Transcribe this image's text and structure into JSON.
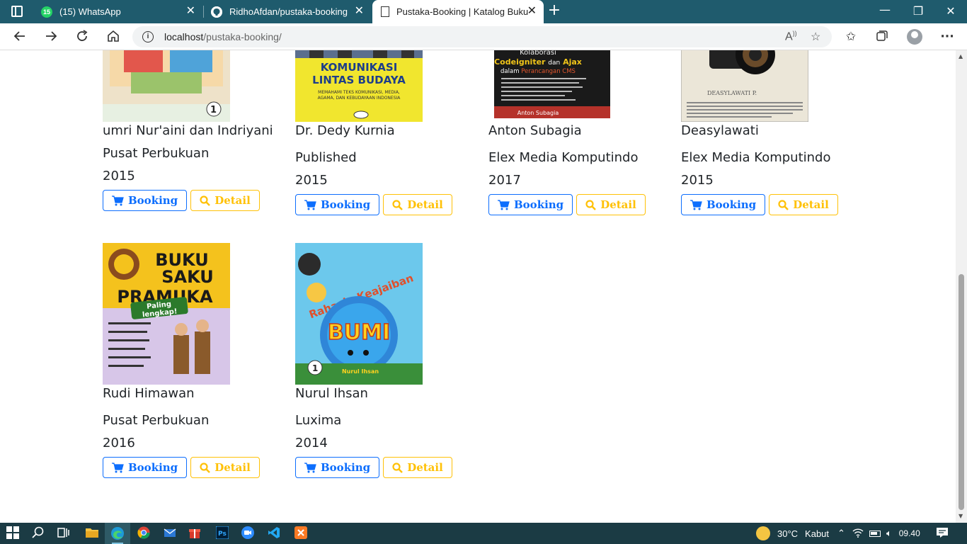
{
  "browser": {
    "tabs": [
      {
        "title": "(15) WhatsApp",
        "badge": "15"
      },
      {
        "title": "RidhoAfdan/pustaka-booking"
      },
      {
        "title": "Pustaka-Booking | Katalog Buku"
      }
    ],
    "url_host": "localhost",
    "url_path": "/pustaka-booking/",
    "icons": {
      "tab_actions": "tabs-icon",
      "back": "back-arrow-icon",
      "forward": "forward-arrow-icon",
      "refresh": "refresh-icon",
      "home": "home-icon",
      "info": "info-icon",
      "read_aloud": "read-aloud-icon",
      "add_favorite": "add-favorite-icon",
      "favorites": "favorites-icon",
      "collections": "collections-icon",
      "profile": "profile-avatar",
      "more": "more-icon"
    }
  },
  "books": [
    {
      "author": "umri Nur'aini dan Indriyani",
      "publisher": "Pusat Perbukuan",
      "year": "2015",
      "cover_text": "",
      "booking_label": "Booking",
      "detail_label": "Detail"
    },
    {
      "author": "Dr. Dedy Kurnia",
      "publisher": "Published",
      "year": "2015",
      "cover_text": "KOMUNIKASI LINTAS BUDAYA",
      "cover_subtext": "MEMAHAMI TEKS KOMUNIKASI, MEDIA, AGAMA, DAN KEBUDAYAAN INDONESIA",
      "booking_label": "Booking",
      "detail_label": "Detail"
    },
    {
      "author": "Anton Subagia",
      "publisher": "Elex Media Komputindo",
      "year": "2017",
      "cover_text": "Kolaborasi Codeigniter dan Ajax dalam Perancangan CMS",
      "cover_subtext": "Anton Subagia",
      "booking_label": "Booking",
      "detail_label": "Detail"
    },
    {
      "author": "Deasylawati",
      "publisher": "Elex Media Komputindo",
      "year": "2015",
      "cover_text": "DEASYLAWATI P.",
      "booking_label": "Booking",
      "detail_label": "Detail"
    },
    {
      "author": "Rudi Himawan",
      "publisher": "Pusat Perbukuan",
      "year": "2016",
      "cover_text": "BUKU SAKU PRAMUKA",
      "cover_subtext": "Paling lengkap!",
      "booking_label": "Booking",
      "detail_label": "Detail"
    },
    {
      "author": "Nurul Ihsan",
      "publisher": "Luxima",
      "year": "2014",
      "cover_text": "Rahasia Keajaiban BUMI",
      "cover_subtext": "Nurul Ihsan",
      "booking_label": "Booking",
      "detail_label": "Detail"
    }
  ],
  "colors": {
    "booking": "#0d6efd",
    "detail": "#ffc107",
    "tabbar": "#1f5b6d",
    "taskbar": "#1b3b44"
  },
  "taskbar": {
    "temperature": "30°C",
    "weather": "Kabut",
    "time": "09.40",
    "apps": [
      "windows-start-icon",
      "search-icon",
      "task-view-icon",
      "file-explorer-icon",
      "edge-icon",
      "chrome-icon",
      "mail-icon",
      "gift-app-icon",
      "photoshop-icon",
      "zoom-icon",
      "vscode-icon",
      "xampp-icon"
    ]
  }
}
